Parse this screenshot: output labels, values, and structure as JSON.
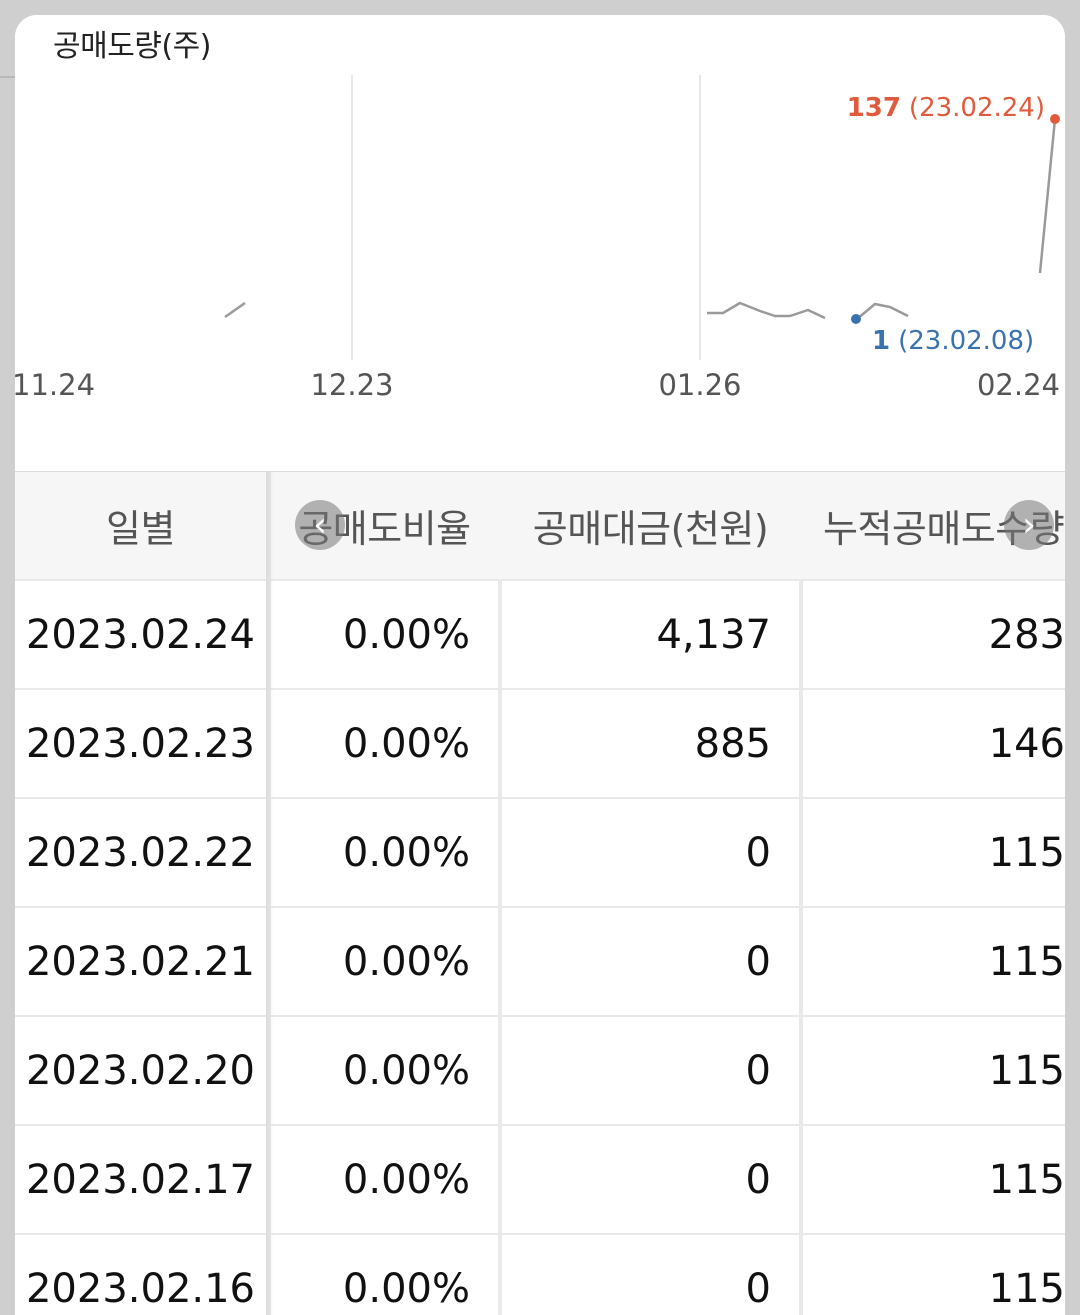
{
  "chart": {
    "title": "공매도량(주)",
    "x_ticks": [
      "11.24",
      "12.23",
      "01.26",
      "02.24"
    ],
    "max_label": {
      "value": "137",
      "date": "(23.02.24)",
      "color": "#e05a3c"
    },
    "min_label": {
      "value": "1",
      "date": "(23.02.08)",
      "color": "#3a72b0"
    },
    "line_color": "#9a9a9a",
    "grid_color": "#e6e6e6"
  },
  "chart_data": {
    "type": "line",
    "title": "공매도량(주)",
    "xlabel": "",
    "ylabel": "",
    "ylim": [
      0,
      140
    ],
    "x_ticks": [
      "11.24",
      "12.23",
      "01.26",
      "02.24"
    ],
    "series": [
      {
        "points": [
          {
            "x": 0,
            "y": 0
          },
          {
            "x": 10,
            "y": 0
          },
          {
            "x": 17,
            "y": 35
          },
          {
            "x": 19,
            "y": 33
          },
          {
            "x": 53,
            "y": 35
          },
          {
            "x": 56,
            "y": 35
          },
          {
            "x": 59,
            "y": 36
          },
          {
            "x": 61,
            "y": 34
          },
          {
            "x": 63,
            "y": 32
          },
          {
            "x": 65,
            "y": 32
          },
          {
            "x": 67,
            "y": 35
          },
          {
            "x": 69,
            "y": 31
          },
          {
            "x": 74,
            "y": 1
          },
          {
            "x": 76,
            "y": 36
          },
          {
            "x": 78,
            "y": 35
          },
          {
            "x": 80,
            "y": 31
          },
          {
            "x": 98,
            "y": 7
          },
          {
            "x": 100,
            "y": 137
          }
        ]
      }
    ],
    "annotations": [
      {
        "label": "137 (23.02.24)",
        "x": 100,
        "y": 137
      },
      {
        "label": "1 (23.02.08)",
        "x": 74,
        "y": 1
      }
    ]
  },
  "table": {
    "headers": [
      "일별",
      "공매도비율",
      "공매대금(천원)",
      "누적공매도수량"
    ],
    "rows": [
      [
        "2023.02.24",
        "0.00%",
        "4,137",
        "283"
      ],
      [
        "2023.02.23",
        "0.00%",
        "885",
        "146"
      ],
      [
        "2023.02.22",
        "0.00%",
        "0",
        "115"
      ],
      [
        "2023.02.21",
        "0.00%",
        "0",
        "115"
      ],
      [
        "2023.02.20",
        "0.00%",
        "0",
        "115"
      ],
      [
        "2023.02.17",
        "0.00%",
        "0",
        "115"
      ],
      [
        "2023.02.16",
        "0.00%",
        "0",
        "115"
      ]
    ],
    "scroll_left_icon": "‹",
    "scroll_right_icon": "›"
  }
}
